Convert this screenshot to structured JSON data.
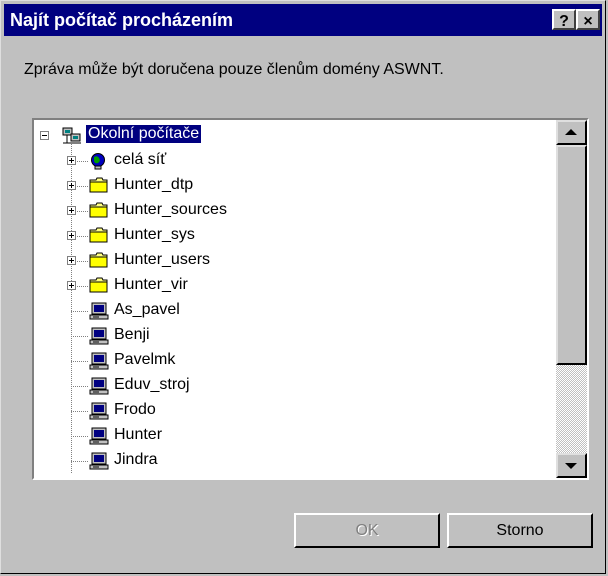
{
  "window": {
    "title": "Najít počítač procházením",
    "help_label": "?",
    "close_label": "×"
  },
  "message": "Zpráva může být doručena pouze členům domény ASWNT.",
  "tree": {
    "root": {
      "label": "Okolní počítače",
      "icon": "network-neighborhood-icon",
      "expanded": true,
      "selected": true
    },
    "items": [
      {
        "label": "celá síť",
        "icon": "globe-icon",
        "expandable": true
      },
      {
        "label": "Hunter_dtp",
        "icon": "folder-icon",
        "expandable": true
      },
      {
        "label": "Hunter_sources",
        "icon": "folder-icon",
        "expandable": true
      },
      {
        "label": "Hunter_sys",
        "icon": "folder-icon",
        "expandable": true
      },
      {
        "label": "Hunter_users",
        "icon": "folder-icon",
        "expandable": true
      },
      {
        "label": "Hunter_vir",
        "icon": "folder-icon",
        "expandable": true
      },
      {
        "label": "As_pavel",
        "icon": "computer-icon",
        "expandable": false
      },
      {
        "label": "Benji",
        "icon": "computer-icon",
        "expandable": false
      },
      {
        "label": "Pavelmk",
        "icon": "computer-icon",
        "expandable": false
      },
      {
        "label": "Eduv_stroj",
        "icon": "computer-icon",
        "expandable": false
      },
      {
        "label": "Frodo",
        "icon": "computer-icon",
        "expandable": false
      },
      {
        "label": "Hunter",
        "icon": "computer-icon",
        "expandable": false
      },
      {
        "label": "Jindra",
        "icon": "computer-icon",
        "expandable": false
      }
    ]
  },
  "buttons": {
    "ok_label": "OK",
    "ok_enabled": false,
    "cancel_label": "Storno"
  },
  "colors": {
    "titlebar": "#000080",
    "face": "#c0c0c0",
    "selection": "#000080"
  }
}
